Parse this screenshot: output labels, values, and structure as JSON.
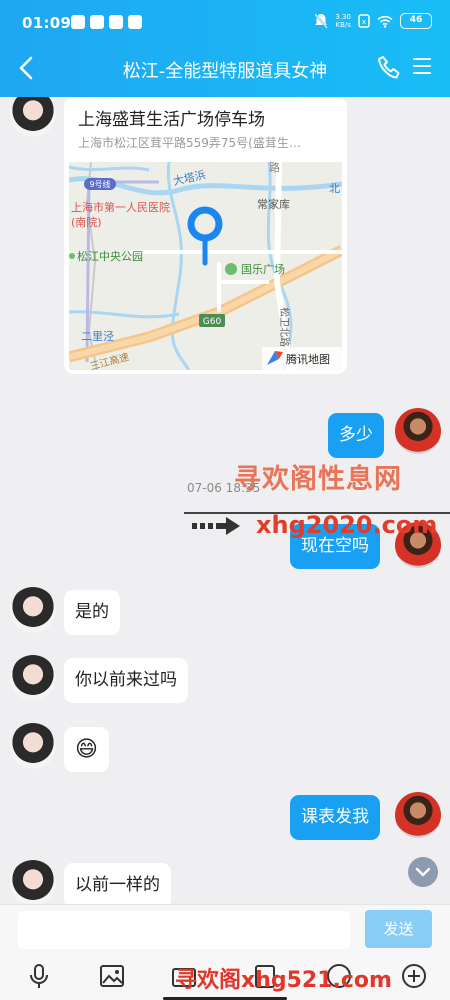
{
  "status_bar": {
    "time": "01:09",
    "net_speed_value": "3.30",
    "net_speed_unit": "KB/s",
    "battery": "46"
  },
  "header": {
    "title": "松江-全能型特服道具女神"
  },
  "messages": {
    "location": {
      "title": "上海盛茸生活广场停车场",
      "address": "上海市松江区茸平路559弄75号(盛茸生…",
      "map_labels": {
        "line9": "9号线",
        "river": "大塔浜",
        "road1": "路",
        "north": "北",
        "hospital": "上海市第一人民医院(南院)",
        "changjiaku": "常家库",
        "park": "松江中央公园",
        "guole": "国乐广场",
        "g60": "G60",
        "erlijing": "二里泾",
        "songwei": "松卫北路",
        "expressway": "三江高速",
        "brand": "腾讯地图"
      }
    },
    "m2": "多少",
    "timestamp": "07-06 18:35",
    "m3": "现在空吗",
    "m4": "是的",
    "m5": "你以前来过吗",
    "m6_emoji": "😄",
    "m7": "课表发我",
    "m8": "以前一样的"
  },
  "watermark": {
    "text1": "寻欢阁性息网",
    "text2": "xhg2020.com",
    "text3": "寻欢阁xhg521.com"
  },
  "input_bar": {
    "send_label": "发送",
    "placeholder": ""
  },
  "colors": {
    "header_start": "#1fa7f2",
    "header_end": "#19bdf6",
    "sent_bubble": "#1aa0f3",
    "send_button": "#88cdf6"
  }
}
